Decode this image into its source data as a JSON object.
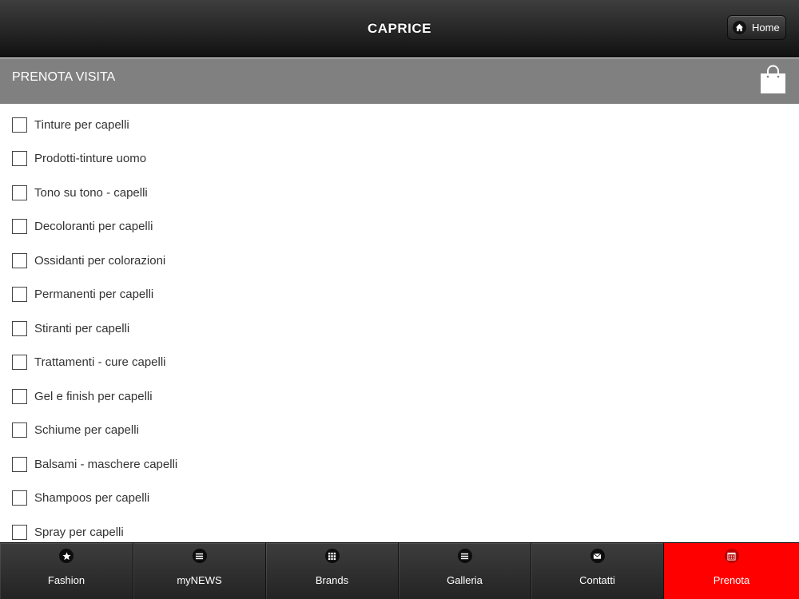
{
  "header": {
    "title": "CAPRICE",
    "home_label": "Home"
  },
  "section": {
    "title": "PRENOTA VISITA"
  },
  "items": [
    {
      "label": "Tinture per capelli",
      "checked": false
    },
    {
      "label": "Prodotti-tinture uomo",
      "checked": false
    },
    {
      "label": "Tono su tono - capelli",
      "checked": false
    },
    {
      "label": "Decoloranti per capelli",
      "checked": false
    },
    {
      "label": "Ossidanti per colorazioni",
      "checked": false
    },
    {
      "label": "Permanenti per capelli",
      "checked": false
    },
    {
      "label": "Stiranti per capelli",
      "checked": false
    },
    {
      "label": "Trattamenti - cure capelli",
      "checked": false
    },
    {
      "label": "Gel e finish per capelli",
      "checked": false
    },
    {
      "label": "Schiume per capelli",
      "checked": false
    },
    {
      "label": "Balsami - maschere capelli",
      "checked": false
    },
    {
      "label": "Shampoos per capelli",
      "checked": false
    },
    {
      "label": "Spray per capelli",
      "checked": false
    }
  ],
  "nav": [
    {
      "label": "Fashion",
      "icon": "star-icon",
      "active": false
    },
    {
      "label": "myNEWS",
      "icon": "list-icon",
      "active": false
    },
    {
      "label": "Brands",
      "icon": "grid-icon",
      "active": false
    },
    {
      "label": "Galleria",
      "icon": "list-icon",
      "active": false
    },
    {
      "label": "Contatti",
      "icon": "mail-icon",
      "active": false
    },
    {
      "label": "Prenota",
      "icon": "calendar-icon",
      "active": true
    }
  ],
  "colors": {
    "active_nav": "#ff0000",
    "section_bar": "#808080"
  }
}
